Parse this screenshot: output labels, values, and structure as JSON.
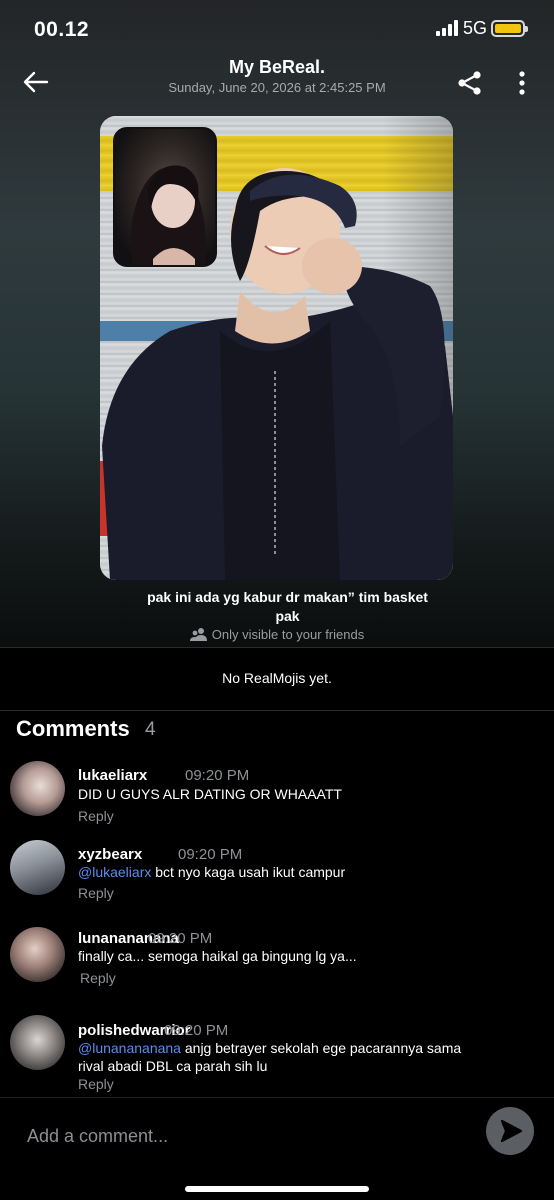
{
  "status_bar": {
    "time": "00.12",
    "network": "5G",
    "battery_color": "#f1c40f"
  },
  "header": {
    "title": "My BeReal.",
    "subtitle": "Sunday, June 20, 2026 at 2:45:25 PM",
    "back_icon": "arrow-left-icon",
    "share_icon": "share-icon",
    "more_icon": "more-vertical-icon"
  },
  "post": {
    "caption": "pak ini ada yg kabur dr makan” tim basket pak",
    "visibility": "Only visible to your friends",
    "realmojis_empty": "No RealMojis yet."
  },
  "comments": {
    "title": "Comments",
    "count": "4",
    "items": [
      {
        "username": "lukaeliarx",
        "time": "09:20 PM",
        "mention": "",
        "text": "DID U GUYS ALR DATING OR WHAAATT",
        "reply": "Reply"
      },
      {
        "username": "xyzbearx",
        "time": "09:20 PM",
        "mention": "@lukaeliarx",
        "text": "bct nyo kaga usah ikut campur",
        "reply": "Reply"
      },
      {
        "username": "lunanananana",
        "time": "09:20 PM",
        "mention": "",
        "text": "finally ca... semoga haikal ga bingung lg ya...",
        "reply": "Reply"
      },
      {
        "username": "polishedwarrior",
        "time": "09:20 PM",
        "mention": "@lunanananana",
        "text": "anjg betrayer sekolah ege pacarannya sama rival abadi DBL ca parah sih lu",
        "reply": "Reply"
      }
    ]
  },
  "composer": {
    "placeholder": "Add a comment...",
    "send_icon": "send-icon",
    "accent": "#5b8def"
  }
}
